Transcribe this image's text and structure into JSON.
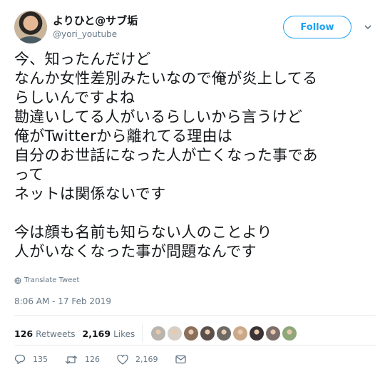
{
  "user": {
    "display_name": "よりひと@サブ垢",
    "handle": "@yori_youtube"
  },
  "follow_label": "Follow",
  "tweet_text": "今、知ったんだけど\nなんか女性差別みたいなので俺が炎上してる\nらしいんですよね\n勘違いしてる人がいるらしいから言うけど\n俺がTwitterから離れてる理由は\n自分のお世話になった人が亡くなった事であ\nって\nネットは関係ないです\n\n今は顔も名前も知らない人のことより\n人がいなくなった事が問題なんです",
  "translate_label": "Translate Tweet",
  "timestamp": "8:06 AM - 17 Feb 2019",
  "stats": {
    "retweets_count": "126",
    "retweets_label": "Retweets",
    "likes_count": "2,169",
    "likes_label": "Likes"
  },
  "likers": [
    "#b9b4ad",
    "#d6d0c8",
    "#8a6f5a",
    "#5a4f4a",
    "#6d6a66",
    "#c9a98a",
    "#3a3234",
    "#7d6e6a",
    "#8fa779"
  ],
  "actions": {
    "reply_count": "135",
    "retweet_count": "126",
    "like_count": "2,169"
  },
  "colors": {
    "accent": "#1da1f2",
    "text": "#14171a",
    "muted": "#657786"
  }
}
